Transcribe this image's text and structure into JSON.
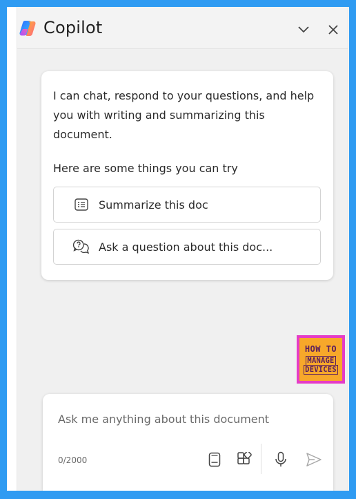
{
  "header": {
    "title": "Copilot",
    "icons": {
      "logo": "copilot-logo",
      "collapse": "chevron-down-icon",
      "close": "close-icon"
    }
  },
  "welcome": {
    "intro": "I can chat, respond to your questions, and help you with writing and summarizing this document.",
    "try_label": "Here are some things you can try",
    "suggestions": [
      {
        "label": "Summarize this doc",
        "icon": "list-document-icon"
      },
      {
        "label": "Ask a question about this doc...",
        "icon": "chat-question-icon"
      }
    ]
  },
  "watermark": {
    "line1": "HOW TO",
    "line2": "MANAGE",
    "line3": "DEVICES"
  },
  "compose": {
    "placeholder": "Ask me anything about this document",
    "value": "",
    "counter": "0/2000",
    "tools": [
      "notebook-icon",
      "apps-icon",
      "microphone-icon",
      "send-icon"
    ]
  },
  "colors": {
    "frame": "#2f9bf2",
    "pane": "#f0f0f0",
    "badge_border": "#e53cc7",
    "badge_fill": "#f7a82a"
  }
}
